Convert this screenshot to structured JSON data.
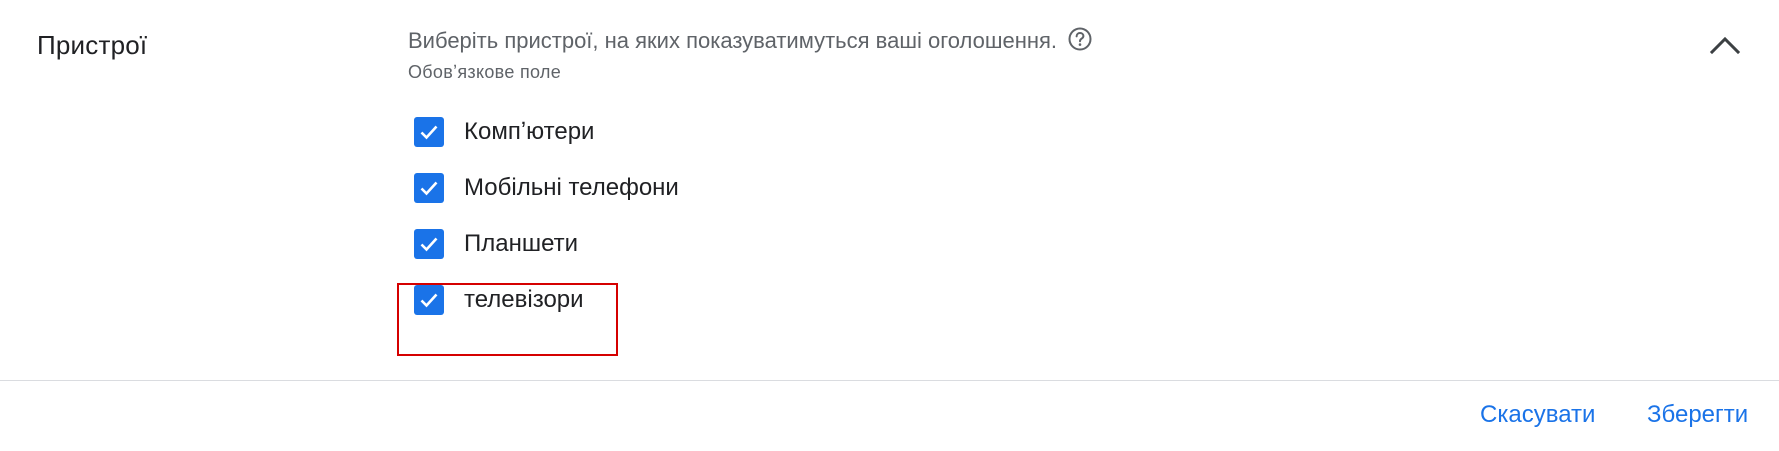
{
  "section": {
    "title": "Пристрої",
    "description": "Виберіть пристрої, на яких показуватимуться ваші оголошення.",
    "required_text": "Обовʼязкове поле",
    "help_icon": "help-circle-icon",
    "collapse_icon": "chevron-up-icon"
  },
  "devices": {
    "items": [
      {
        "label": "Компʼютери",
        "checked": true
      },
      {
        "label": "Мобільні телефони",
        "checked": true
      },
      {
        "label": "Планшети",
        "checked": true
      },
      {
        "label": "телевізори",
        "checked": true
      }
    ]
  },
  "footer": {
    "cancel_label": "Скасувати",
    "save_label": "Зберегти"
  },
  "colors": {
    "accent": "#1a73e8",
    "highlight": "#d50000",
    "divider": "#dadce0",
    "text_primary": "#202124",
    "text_secondary": "#5f6368"
  }
}
